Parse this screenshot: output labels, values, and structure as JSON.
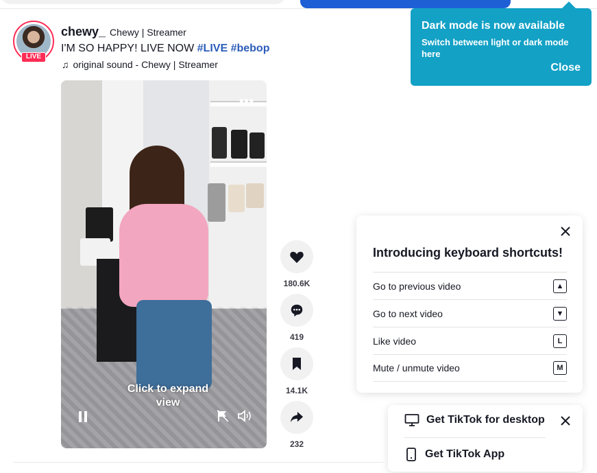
{
  "dark_mode_tip": {
    "title": "Dark mode is now available",
    "body": "Switch between light or dark mode here",
    "close_label": "Close"
  },
  "post": {
    "live_badge": "LIVE",
    "username": "chewy_",
    "nickname": "Chewy | Streamer",
    "caption_text": "I'M SO HAPPY! LIVE NOW ",
    "hashtags": [
      "#LIVE",
      "#bebop"
    ],
    "music": "original sound - Chewy | Streamer",
    "video": {
      "more_label": "•••",
      "expand_label": "Click to expand view"
    },
    "actions": {
      "likes": "180.6K",
      "comments": "419",
      "saves": "14.1K",
      "shares": "232"
    }
  },
  "keyboard_shortcuts": {
    "title": "Introducing keyboard shortcuts!",
    "rows": [
      {
        "label": "Go to previous video",
        "key": "▲"
      },
      {
        "label": "Go to next video",
        "key": "▼"
      },
      {
        "label": "Like video",
        "key": "L"
      },
      {
        "label": "Mute / unmute video",
        "key": "M"
      }
    ]
  },
  "get_app": {
    "desktop_label": "Get TikTok for desktop",
    "app_label": "Get TikTok App"
  },
  "colors": {
    "accent_blue": "#13a1c6",
    "live_red": "#fe2c55",
    "hashtag": "#2b5db9"
  }
}
